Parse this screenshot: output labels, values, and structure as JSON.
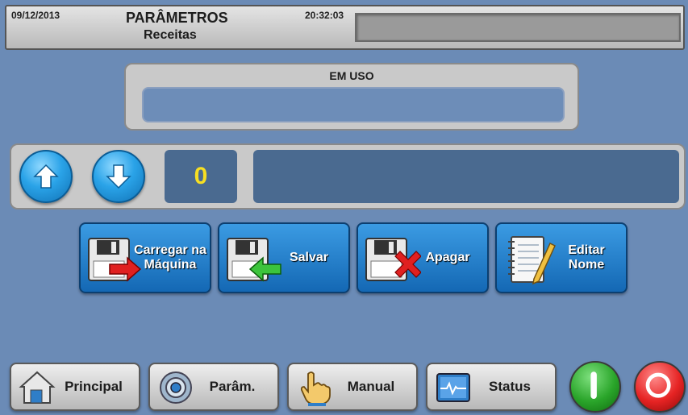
{
  "header": {
    "date": "09/12/2013",
    "title": "PARÂMETROS",
    "subtitle": "Receitas",
    "time": "20:32:03",
    "message": ""
  },
  "in_use": {
    "label": "EM USO",
    "value": ""
  },
  "recipe": {
    "number": "0",
    "name": "",
    "up_icon": "arrow-up-icon",
    "down_icon": "arrow-down-icon"
  },
  "actions": [
    {
      "label": "Carregar na Máquina",
      "icon": "floppy-load-icon"
    },
    {
      "label": "Salvar",
      "icon": "floppy-save-icon"
    },
    {
      "label": "Apagar",
      "icon": "floppy-delete-icon"
    },
    {
      "label": "Editar Nome",
      "icon": "notepad-edit-icon"
    }
  ],
  "nav": [
    {
      "label": "Principal",
      "icon": "home-icon"
    },
    {
      "label": "Parâm.",
      "icon": "gear-icon"
    },
    {
      "label": "Manual",
      "icon": "hand-icon"
    },
    {
      "label": "Status",
      "icon": "monitor-icon"
    }
  ],
  "controls": {
    "start_icon": "power-on-icon",
    "stop_icon": "power-off-icon"
  },
  "colors": {
    "background": "#6b8bb6",
    "button_blue": "#1f7fcf",
    "number_yellow": "#f7df22",
    "start_green": "#2aa52a",
    "stop_red": "#e62323"
  }
}
